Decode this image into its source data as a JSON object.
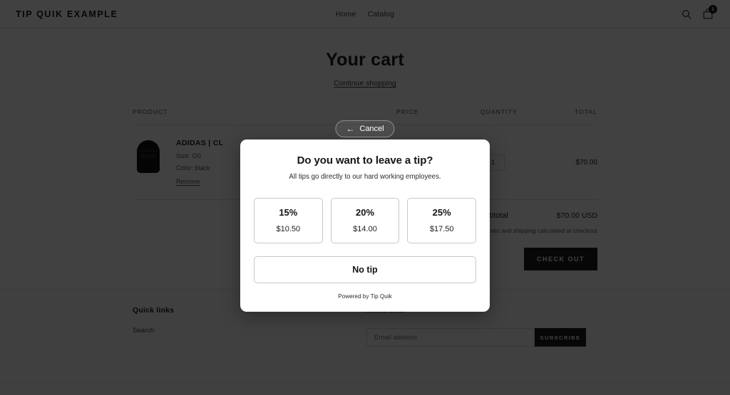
{
  "header": {
    "brand": "TIP QUIK EXAMPLE",
    "nav": [
      {
        "label": "Home"
      },
      {
        "label": "Catalog"
      }
    ],
    "search_icon": "search-icon",
    "cart_icon": "cart-icon",
    "cart_count": "1"
  },
  "cart": {
    "title": "Your cart",
    "continue_shopping": "Continue shopping",
    "columns": {
      "product": "PRODUCT",
      "price": "PRICE",
      "quantity": "QUANTITY",
      "total": "TOTAL"
    },
    "items": [
      {
        "title": "ADIDAS | CL",
        "size": "Size: OS",
        "color": "Color: black",
        "remove": "Remove",
        "price": "",
        "quantity": "1",
        "total": "$70.00"
      }
    ],
    "subtotal_label": "Subtotal",
    "subtotal_value": "$70.00 USD",
    "tax_note": "Taxes and shipping calculated at checkout",
    "checkout_label": "CHECK OUT"
  },
  "modal": {
    "cancel_label": "Cancel",
    "cancel_arrow": "←",
    "title": "Do you want to leave a tip?",
    "subtitle": "All tips go directly to our hard working employees.",
    "options": [
      {
        "percent": "15%",
        "amount": "$10.50"
      },
      {
        "percent": "20%",
        "amount": "$14.00"
      },
      {
        "percent": "25%",
        "amount": "$17.50"
      }
    ],
    "no_tip_label": "No tip",
    "powered_by": "Powered by Tip Quik"
  },
  "footer": {
    "quick_links_heading": "Quick links",
    "quick_links": [
      {
        "label": "Search"
      }
    ],
    "newsletter_heading": "Newsletter",
    "email_placeholder": "Email address",
    "subscribe_label": "SUBSCRIBE"
  },
  "colors": {
    "ink": "#1c1d1d",
    "overlay": "rgba(0,0,0,0.745)",
    "modal_bg": "#ffffff",
    "border": "#c9c9c9"
  }
}
